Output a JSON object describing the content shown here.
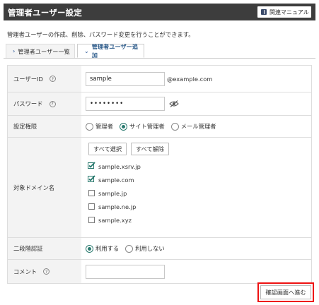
{
  "header": {
    "title": "管理者ユーザー設定",
    "manual_label": "関連マニュアル"
  },
  "description": "管理者ユーザーの作成、削除、パスワード変更を行うことができます。",
  "tabs": [
    {
      "label": "管理者ユーザー一覧",
      "active": false
    },
    {
      "label": "管理者ユーザー追加",
      "active": true
    }
  ],
  "form": {
    "user_id": {
      "label": "ユーザーID",
      "value": "sample",
      "suffix": "@example.com"
    },
    "password": {
      "label": "パスワード",
      "value": "••••••••"
    },
    "permission": {
      "label": "設定権限",
      "options": [
        "管理者",
        "サイト管理者",
        "メール管理者"
      ],
      "selected": "サイト管理者"
    },
    "domains": {
      "label": "対象ドメイン名",
      "select_all": "すべて選択",
      "deselect_all": "すべて解除",
      "items": [
        {
          "name": "sample.xsrv.jp",
          "checked": true
        },
        {
          "name": "sample.com",
          "checked": true
        },
        {
          "name": "sample.jp",
          "checked": false
        },
        {
          "name": "sample.ne.jp",
          "checked": false
        },
        {
          "name": "sample.xyz",
          "checked": false
        }
      ]
    },
    "two_factor": {
      "label": "二段階認証",
      "options": [
        "利用する",
        "利用しない"
      ],
      "selected": "利用する"
    },
    "comment": {
      "label": "コメント",
      "value": ""
    }
  },
  "confirm_label": "確認画面へ進む",
  "colors": {
    "header_bg": "#3d3d3d",
    "accent": "#2a7a6f",
    "highlight": "#ee1111"
  }
}
